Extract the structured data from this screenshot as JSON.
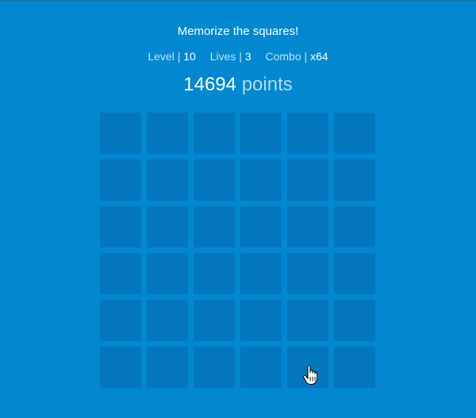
{
  "game": {
    "instruction": "Memorize the squares!",
    "stats": {
      "level_label": "Level",
      "level_value": "10",
      "lives_label": "Lives",
      "lives_value": "3",
      "combo_label": "Combo",
      "combo_value": "x64",
      "separator": "|"
    },
    "score": {
      "value": "14694",
      "unit": "points"
    },
    "board": {
      "rows": 6,
      "cols": 6
    },
    "colors": {
      "background": "#0288d1",
      "tile": "#0277bd",
      "text": "#ffffff",
      "muted_text": "#bfe3f6"
    },
    "cursor_icon": "hand-pointer-icon"
  }
}
